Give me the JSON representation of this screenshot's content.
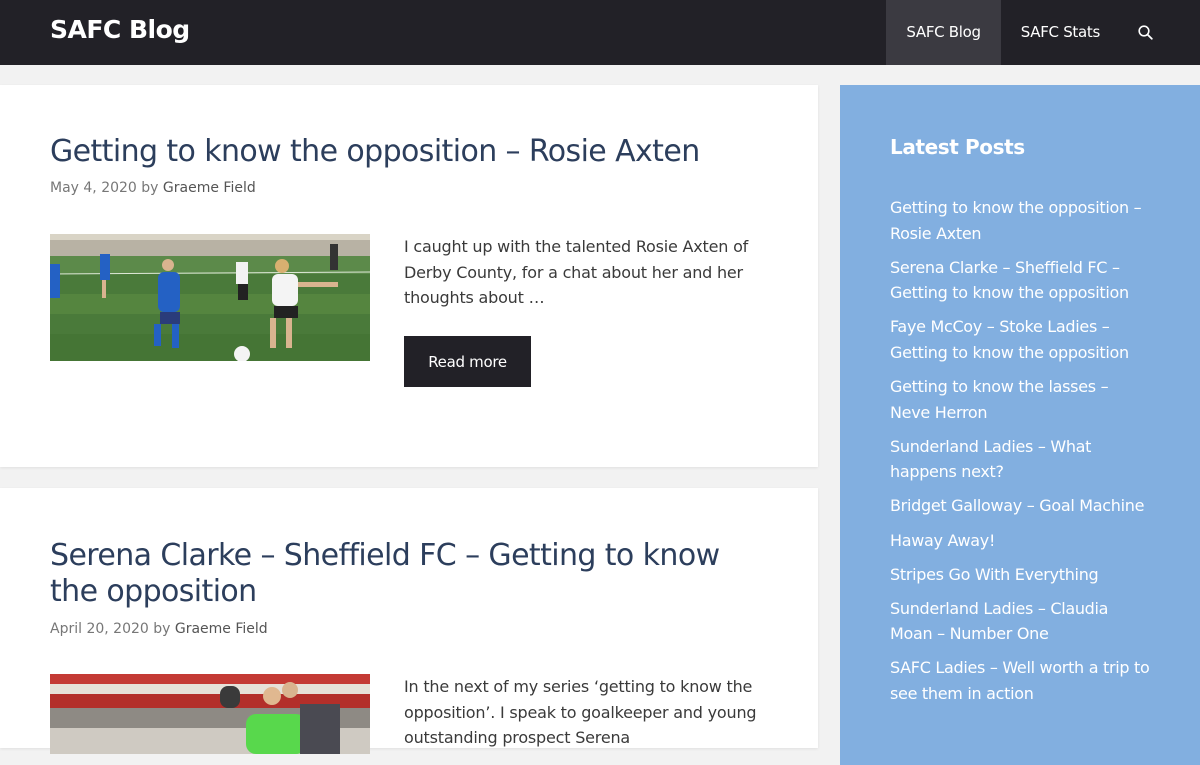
{
  "header": {
    "site_title": "SAFC Blog",
    "nav": [
      {
        "label": "SAFC Blog",
        "active": true
      },
      {
        "label": "SAFC Stats",
        "active": false
      }
    ],
    "search_icon": "search-icon"
  },
  "posts": [
    {
      "title": "Getting to know the opposition – Rosie Axten",
      "date": "May 4, 2020",
      "by": "by",
      "author": "Graeme Field",
      "excerpt": "I caught up with the talented Rosie Axten of Derby County, for a chat about her and her thoughts about …",
      "read_more": "Read more"
    },
    {
      "title": "Serena Clarke – Sheffield FC – Getting to know the opposition",
      "date": "April 20, 2020",
      "by": "by",
      "author": "Graeme Field",
      "excerpt": "In the next of my series ‘getting to know the opposition’. I speak to goalkeeper and young outstanding prospect Serena"
    }
  ],
  "sidebar": {
    "title": "Latest Posts",
    "items": [
      "Getting to know the opposition – Rosie Axten",
      "Serena Clarke – Sheffield FC – Getting to know the opposition",
      "Faye McCoy – Stoke Ladies – Getting to know the opposition",
      "Getting to know the lasses – Neve Herron",
      "Sunderland Ladies – What happens next?",
      "Bridget Galloway – Goal Machine",
      "Haway Away!",
      "Stripes Go With Everything",
      "Sunderland Ladies – Claudia Moan – Number One",
      "SAFC Ladies – Well worth a trip to see them in action"
    ]
  },
  "colors": {
    "header_bg": "#222127",
    "sidebar_bg": "#82afe0",
    "title_color": "#2c3e5c"
  }
}
